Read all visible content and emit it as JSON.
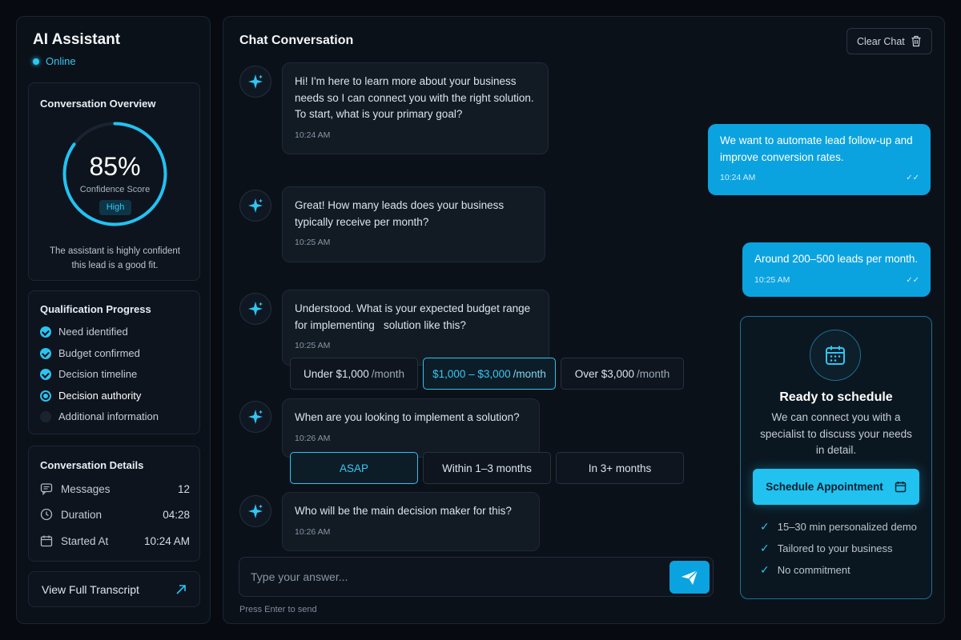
{
  "sidebar": {
    "app_title": "AI Assistant",
    "status": "Online",
    "overview": {
      "title": "Conversation Overview",
      "confidence_pct": "85%",
      "confidence_value": 0.85,
      "confidence_label": "Confidence Score",
      "badge": "High",
      "description": "The assistant is highly confident this lead is a good fit."
    },
    "progress": {
      "title": "Qualification Progress",
      "items": [
        {
          "label": "Need identified",
          "state": "done"
        },
        {
          "label": "Budget confirmed",
          "state": "done"
        },
        {
          "label": "Decision timeline",
          "state": "done"
        },
        {
          "label": "Decision authority",
          "state": "current"
        },
        {
          "label": "Additional information",
          "state": "pending"
        }
      ]
    },
    "details": {
      "title": "Conversation Details",
      "rows": [
        {
          "label": "Messages",
          "value": "12",
          "icon": "message-icon"
        },
        {
          "label": "Duration",
          "value": "04:28",
          "icon": "clock-icon"
        },
        {
          "label": "Started At",
          "value": "10:24 AM",
          "icon": "calendar-icon"
        }
      ]
    },
    "transcript_label": "View Full Transcript"
  },
  "chat": {
    "title": "Chat Conversation",
    "clear_label": "Clear Chat",
    "messages": [
      {
        "from": "bot",
        "text": "Hi! I'm here to learn more about your business needs so I can connect you with the right solution.\nTo start, what is your primary goal?",
        "time": "10:24 AM"
      },
      {
        "from": "user",
        "text": "We want to automate lead follow-up and improve conversion rates.",
        "time": "10:24 AM"
      },
      {
        "from": "bot",
        "text": "Great! How many leads does your business typically receive per month?",
        "time": "10:25 AM"
      },
      {
        "from": "user",
        "text": "Around 200–500 leads per month.",
        "time": "10:25 AM"
      },
      {
        "from": "bot",
        "text": "Understood. What is your expected budget range for implementing   solution like this?",
        "time": "10:25 AM"
      },
      {
        "from": "bot",
        "text": "When are you looking to implement a solution?",
        "time": "10:26 AM"
      },
      {
        "from": "bot",
        "text": "Who will be the main decision maker for this?",
        "time": "10:26 AM"
      }
    ],
    "budget_options": [
      {
        "label": "Under $1,000",
        "unit": "/month"
      },
      {
        "label": "$1,000 – $3,000",
        "unit": "/month"
      },
      {
        "label": "Over $3,000",
        "unit": "/month"
      }
    ],
    "timeline_options": [
      {
        "label": "ASAP"
      },
      {
        "label": "Within 1–3 months"
      },
      {
        "label": "In 3+ months"
      }
    ],
    "input_placeholder": "Type your answer...",
    "hint": "Press Enter to send"
  },
  "schedule": {
    "title": "Ready to schedule",
    "description": "We can connect you with a specialist to discuss your needs in detail.",
    "button_label": "Schedule Appointment",
    "perks": [
      "15–30 min personalized demo",
      "Tailored to your business",
      "No commitment"
    ]
  },
  "colors": {
    "accent": "#21c1f0",
    "background": "#070b11",
    "user_bubble": "#0aa3e0"
  }
}
